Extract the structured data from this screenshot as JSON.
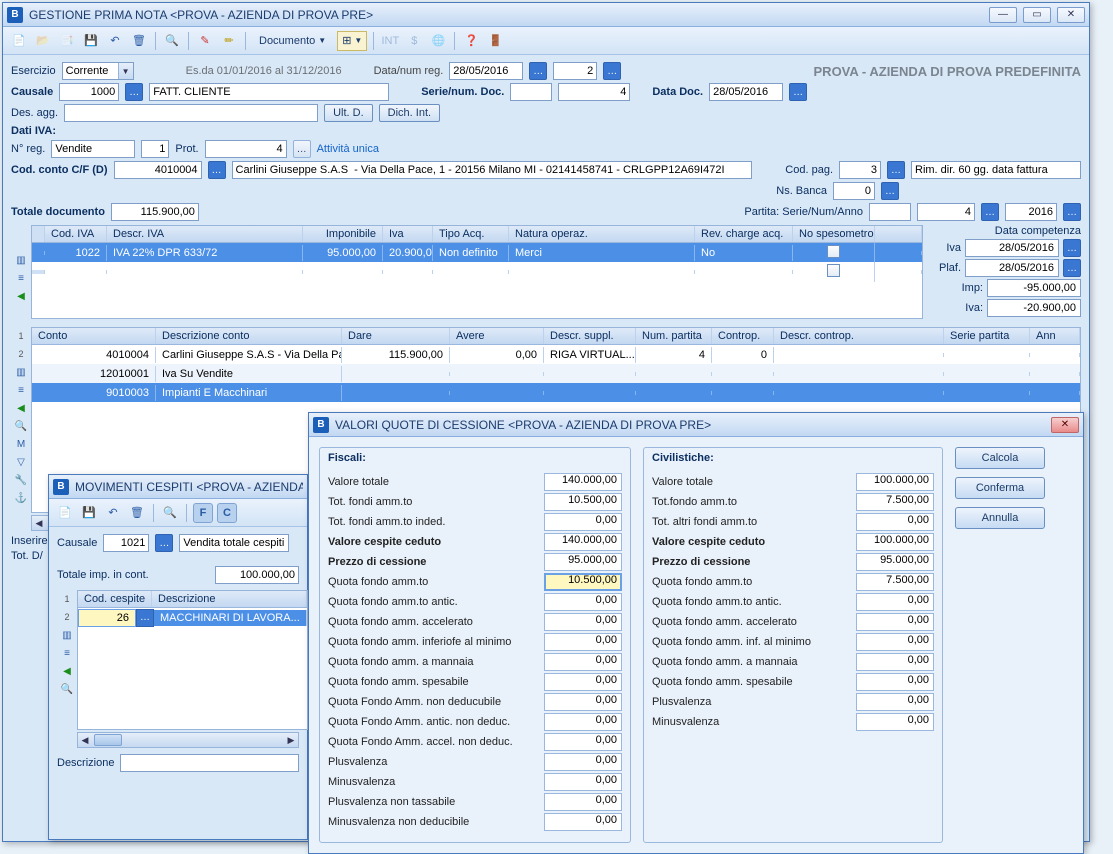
{
  "main": {
    "title": "GESTIONE PRIMA NOTA <PROVA - AZIENDA DI PROVA PRE>",
    "company_faded": "PROVA - AZIENDA DI PROVA PREDEFINITA",
    "esercizio_label": "Esercizio",
    "esercizio_value": "Corrente",
    "esercizio_range": "Es.da 01/01/2016 al 31/12/2016",
    "data_numreg_label": "Data/num reg.",
    "data_reg": "28/05/2016",
    "num_reg": "2",
    "causale_label": "Causale",
    "causale_code": "1000",
    "causale_desc": "FATT. CLIENTE",
    "serie_num_doc_label": "Serie/num. Doc.",
    "serie_doc": "",
    "num_doc": "4",
    "data_doc_label": "Data Doc.",
    "data_doc": "28/05/2016",
    "des_agg_label": "Des. agg.",
    "des_agg": "",
    "ult_d": "Ult. D.",
    "dich_int": "Dich. Int.",
    "dati_iva": "Dati IVA:",
    "nreg_label": "N° reg.",
    "nreg_type": "Vendite",
    "nreg_num": "1",
    "prot_label": "Prot.",
    "prot_num": "4",
    "attivita_unica": "Attività unica",
    "cod_conto_label": "Cod. conto C/F  (D)",
    "cod_conto": "4010004",
    "anagrafica": "Carlini Giuseppe S.A.S  - Via Della Pace, 1 - 20156 Milano MI - 02141458741 - CRLGPP12A69I472I",
    "cod_pag_label": "Cod. pag.",
    "cod_pag": "3",
    "cod_pag_desc": "Rim. dir. 60 gg. data fattura",
    "ns_banca_label": "Ns. Banca",
    "ns_banca": "0",
    "totale_doc_label": "Totale documento",
    "totale_doc": "115.900,00",
    "partita_label": "Partita: Serie/Num/Anno",
    "partita_serie": "",
    "partita_num": "4",
    "partita_anno": "2016",
    "data_competenza_label": "Data competenza",
    "iva_tab": {
      "cols": [
        "Cod. IVA",
        "Descr. IVA",
        "Imponibile",
        "Iva",
        "Tipo Acq.",
        "Natura operaz.",
        "Rev. charge acq.",
        "No spesometro"
      ],
      "rows": [
        {
          "cod": "1022",
          "descr": "IVA 22% DPR 633/72",
          "imponibile": "95.000,00",
          "iva": "20.900,0",
          "tipo": "Non definito",
          "natura": "Merci",
          "rev": "No"
        }
      ]
    },
    "right_kv": {
      "iva_label": "Iva",
      "iva_date": "28/05/2016",
      "plaf_label": "Plaf.",
      "plaf_date": "28/05/2016",
      "imp_label": "Imp:",
      "imp_val": "-95.000,00",
      "iva2_label": "Iva:",
      "iva2_val": "-20.900,00"
    },
    "conti_tab": {
      "cols": [
        "Conto",
        "Descrizione conto",
        "Dare",
        "Avere",
        "Descr. suppl.",
        "Num. partita",
        "Controp.",
        "Descr. controp.",
        "Serie partita",
        "Ann"
      ],
      "rows": [
        {
          "n": "1",
          "conto": "4010004",
          "descr": "Carlini Giuseppe S.A.S  - Via Della Pac...",
          "dare": "115.900,00",
          "avere": "0,00",
          "suppl": "RIGA VIRTUAL...",
          "num": "4",
          "controp": "0"
        },
        {
          "n": "2",
          "conto": "12010001",
          "descr": "Iva Su Vendite"
        },
        {
          "n": "",
          "conto": "9010003",
          "descr": "Impianti E Macchinari"
        }
      ]
    },
    "inserire_label": "Inserire",
    "totd_label": "Tot. D/",
    "toolbar": {
      "documento": "Documento"
    }
  },
  "mov": {
    "title": "MOVIMENTI CESPITI <PROVA - AZIENDA DI",
    "causale_label": "Causale",
    "causale_code": "1021",
    "causale_desc": "Vendita totale cespiti",
    "tot_imp_label": "Totale imp. in cont.",
    "tot_imp": "100.000,00",
    "cols": [
      "Cod. cespite",
      "Descrizione"
    ],
    "row_cod": "26",
    "row_desc": "MACCHINARI DI LAVORA...",
    "descr_label": "Descrizione"
  },
  "val": {
    "title": "VALORI QUOTE DI CESSIONE <PROVA - AZIENDA DI PROVA PRE>",
    "fiscali": "Fiscali:",
    "civilistiche": "Civilistiche:",
    "btn_calcola": "Calcola",
    "btn_conferma": "Conferma",
    "btn_annulla": "Annulla",
    "fisc": [
      {
        "l": "Valore totale",
        "v": "140.000,00"
      },
      {
        "l": "Tot. fondi amm.to",
        "v": "10.500,00"
      },
      {
        "l": "Tot. fondi amm.to inded.",
        "v": "0,00"
      },
      {
        "l": "Valore cespite ceduto",
        "v": "140.000,00",
        "b": true
      },
      {
        "l": "Prezzo di cessione",
        "v": "95.000,00",
        "b": true
      },
      {
        "l": "Quota fondo amm.to",
        "v": "10.500,00",
        "hl": true
      },
      {
        "l": "Quota fondo amm.to antic.",
        "v": "0,00"
      },
      {
        "l": "Quota fondo amm. accelerato",
        "v": "0,00"
      },
      {
        "l": "Quota fondo amm. inferiofe al minimo",
        "v": "0,00"
      },
      {
        "l": "Quota fondo amm. a mannaia",
        "v": "0,00"
      },
      {
        "l": "Quota fondo amm. spesabile",
        "v": "0,00"
      },
      {
        "l": "Quota Fondo Amm. non deducubile",
        "v": "0,00"
      },
      {
        "l": "Quota Fondo Amm. antic. non deduc.",
        "v": "0,00"
      },
      {
        "l": "Quota Fondo Amm. accel. non deduc.",
        "v": "0,00"
      },
      {
        "l": "Plusvalenza",
        "v": "0,00"
      },
      {
        "l": "Minusvalenza",
        "v": "0,00"
      },
      {
        "l": "Plusvalenza non tassabile",
        "v": "0,00"
      },
      {
        "l": "Minusvalenza non deducibile",
        "v": "0,00"
      }
    ],
    "civ": [
      {
        "l": "Valore totale",
        "v": "100.000,00"
      },
      {
        "l": "Tot.fondo amm.to",
        "v": "7.500,00"
      },
      {
        "l": "Tot. altri fondi amm.to",
        "v": "0,00"
      },
      {
        "l": "Valore cespite ceduto",
        "v": "100.000,00",
        "b": true
      },
      {
        "l": "Prezzo di cessione",
        "v": "95.000,00",
        "b": true
      },
      {
        "l": "Quota fondo amm.to",
        "v": "7.500,00"
      },
      {
        "l": "Quota fondo amm.to antic.",
        "v": "0,00"
      },
      {
        "l": "Quota fondo amm. accelerato",
        "v": "0,00"
      },
      {
        "l": "Quota fondo amm. inf. al minimo",
        "v": "0,00"
      },
      {
        "l": "Quota fondo amm. a mannaia",
        "v": "0,00"
      },
      {
        "l": "Quota fondo amm. spesabile",
        "v": "0,00"
      },
      {
        "l": "Plusvalenza",
        "v": "0,00"
      },
      {
        "l": "Minusvalenza",
        "v": "0,00"
      }
    ]
  }
}
